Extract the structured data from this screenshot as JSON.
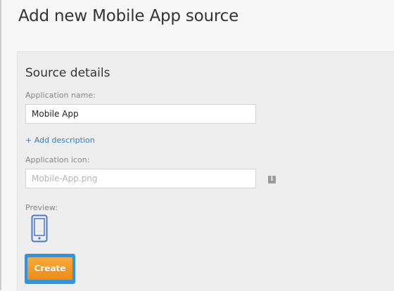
{
  "page": {
    "title": "Add new Mobile App source"
  },
  "form": {
    "section_title": "Source details",
    "app_name": {
      "label": "Application name:",
      "value": "Mobile App"
    },
    "add_description_label": "+ Add description",
    "app_icon": {
      "label": "Application icon:",
      "placeholder": "Mobile-App.png",
      "info_icon": "i"
    },
    "preview": {
      "label": "Preview:",
      "icon": "mobile-phone-icon"
    },
    "create_label": "Create"
  },
  "colors": {
    "accent_blue": "#2b95e8",
    "button_orange": "#f29a22",
    "link_blue": "#2f7fbf",
    "phone_blue": "#4a78c9"
  }
}
